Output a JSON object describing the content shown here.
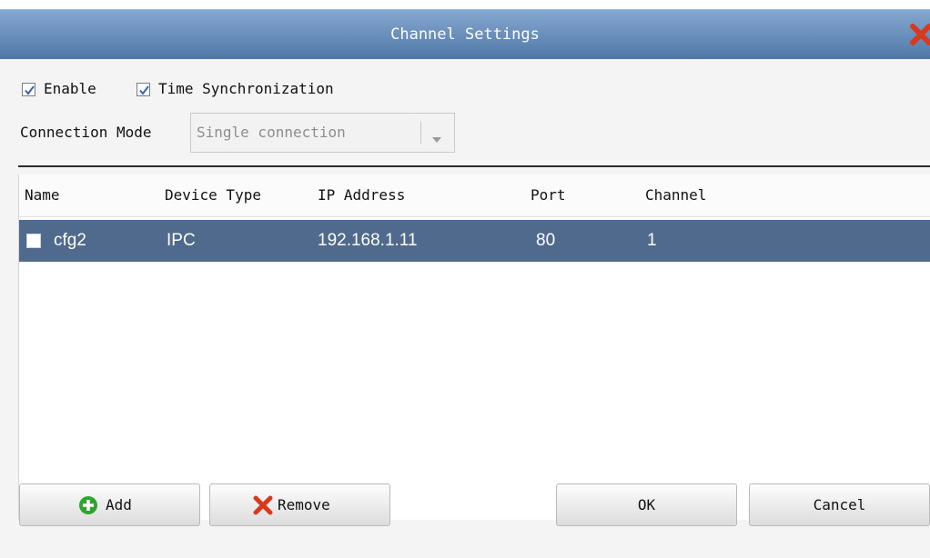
{
  "window": {
    "title": "Channel Settings",
    "close_icon": "close-icon",
    "accent": "#5b81b1"
  },
  "options": {
    "enable": {
      "label": "Enable",
      "checked": true
    },
    "time_sync": {
      "label": "Time Synchronization",
      "checked": true
    }
  },
  "connection_mode": {
    "label": "Connection Mode",
    "value": "Single connection"
  },
  "table": {
    "columns": [
      "Name",
      "Device Type",
      "IP Address",
      "Port",
      "Channel"
    ],
    "rows": [
      {
        "name": "cfg2",
        "device_type": "IPC",
        "ip": "192.168.1.11",
        "port": "80",
        "channel": "1",
        "checked": false,
        "selected": true
      }
    ]
  },
  "buttons": {
    "add": "Add",
    "remove": "Remove",
    "ok": "OK",
    "cancel": "Cancel"
  }
}
